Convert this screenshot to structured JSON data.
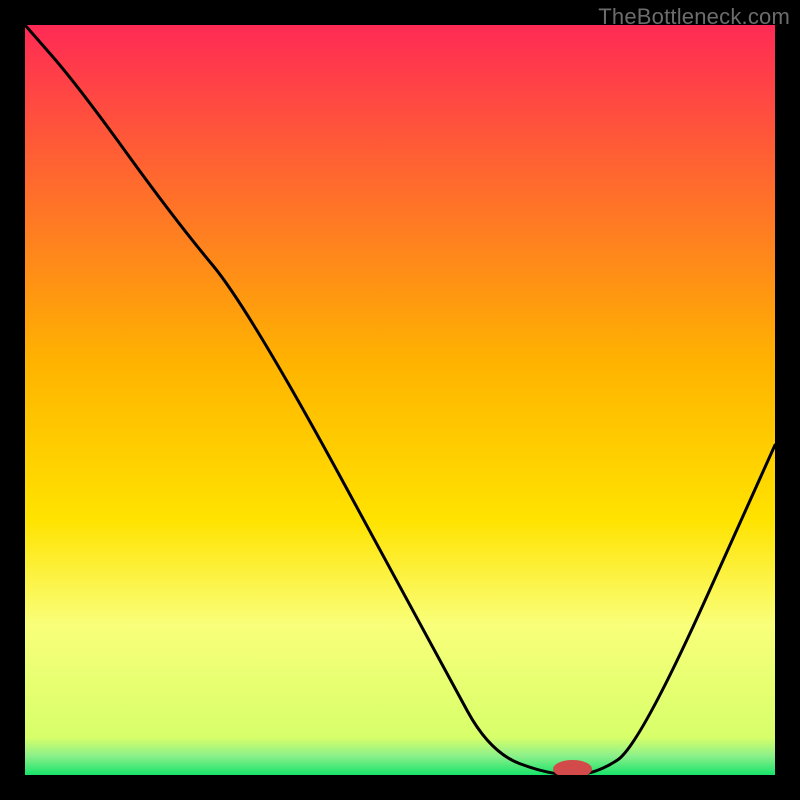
{
  "watermark": "TheBottleneck.com",
  "colors": {
    "frame": "#000000",
    "top": "#ff2a55",
    "mid": "#ffd500",
    "low": "#f7ff8a",
    "green": "#17e36a",
    "curve": "#000000",
    "marker": "#d24a4a"
  },
  "chart_data": {
    "type": "line",
    "title": "",
    "xlabel": "",
    "ylabel": "",
    "xlim": [
      0,
      100
    ],
    "ylim": [
      0,
      100
    ],
    "series": [
      {
        "name": "bottleneck-curve",
        "x": [
          0,
          7,
          20,
          30,
          56,
          62,
          70,
          76,
          82,
          100
        ],
        "y": [
          100,
          92,
          74,
          62,
          14,
          3,
          0,
          0,
          4,
          44
        ]
      }
    ],
    "marker": {
      "x": 73,
      "y": 0.8,
      "rx": 2.6,
      "ry": 1.2
    },
    "gradient_stops": [
      {
        "offset": 0,
        "color": "#ff2a55"
      },
      {
        "offset": 0.45,
        "color": "#ffb300"
      },
      {
        "offset": 0.66,
        "color": "#ffe300"
      },
      {
        "offset": 0.8,
        "color": "#f9ff7a"
      },
      {
        "offset": 0.95,
        "color": "#d7ff6a"
      },
      {
        "offset": 0.975,
        "color": "#8af08a"
      },
      {
        "offset": 1.0,
        "color": "#17e36a"
      }
    ]
  }
}
